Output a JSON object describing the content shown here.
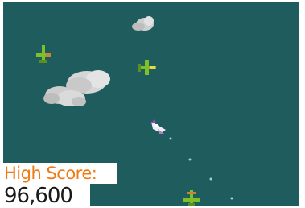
{
  "hud": {
    "high_score_label": "High Score:",
    "high_score_value": "96,600"
  },
  "colors": {
    "sea": "#1e5c5e",
    "label_orange": "#f07a14",
    "score_text": "#1a1a1a",
    "enemy_plane": "#7fbf2a",
    "player_plane": "#e8e8f0",
    "player_trim": "#8a4fa8",
    "cloud": "#d8d8d8"
  },
  "sprites": {
    "clouds": [
      "cloud-small-icon",
      "cloud-large-icon"
    ],
    "enemies": [
      "enemy-plane-icon",
      "enemy-plane-icon",
      "enemy-plane-icon"
    ],
    "player": "player-plane-icon",
    "bullets": "bullet-icon"
  }
}
